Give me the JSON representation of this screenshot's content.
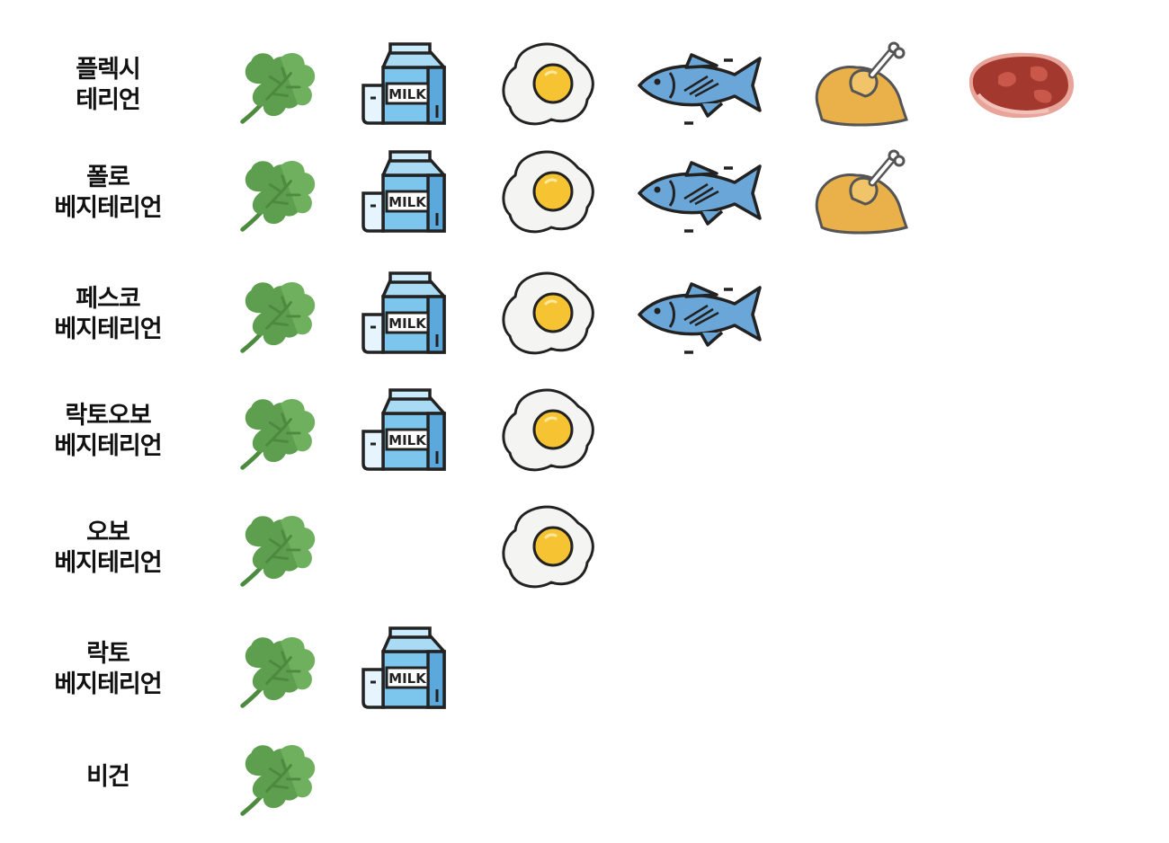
{
  "rows": [
    {
      "line1": "플렉시",
      "line2": "테리언",
      "foods": [
        "vegetable",
        "milk",
        "egg",
        "fish",
        "chicken",
        "meat"
      ]
    },
    {
      "line1": "폴로",
      "line2": "베지테리언",
      "foods": [
        "vegetable",
        "milk",
        "egg",
        "fish",
        "chicken"
      ]
    },
    {
      "line1": "페스코",
      "line2": "베지테리언",
      "foods": [
        "vegetable",
        "milk",
        "egg",
        "fish"
      ]
    },
    {
      "line1": "락토오보",
      "line2": "베지테리언",
      "foods": [
        "vegetable",
        "milk",
        "egg"
      ]
    },
    {
      "line1": "오보",
      "line2": "베지테리언",
      "foods": [
        "vegetable",
        "egg"
      ]
    },
    {
      "line1": "락토",
      "line2": "베지테리언",
      "foods": [
        "vegetable",
        "milk"
      ]
    },
    {
      "line1": "비건",
      "line2": "",
      "foods": [
        "vegetable"
      ]
    }
  ],
  "milk_text": "MILK",
  "colors": {
    "vegetable": "#5e9e4f",
    "milk": "#7cc6ee",
    "egg_yolk": "#f6c332",
    "fish": "#6aa7d8",
    "chicken": "#eab04a",
    "meat": "#a3382e",
    "outline": "#222222"
  }
}
